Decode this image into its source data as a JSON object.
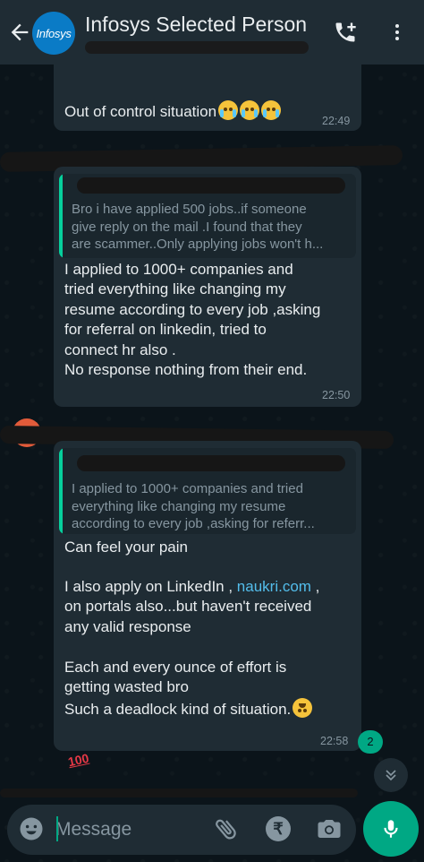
{
  "header": {
    "title": "Infosys Selected Person",
    "avatar_text": "Infosys"
  },
  "messages": [
    {
      "text": "Out of control situation",
      "time": "22:49"
    },
    {
      "quote": "Bro i have applied 500 jobs..if someone\ngive reply on the mail .I found that they\nare scammer..Only applying jobs won't h...",
      "text": "I applied to 1000+ companies and\ntried everything like changing my\nresume according to every job ,asking\nfor  referral on linkedin, tried to\nconnect hr also .\nNo response nothing from their end.",
      "time": "22:50"
    },
    {
      "quote": "I applied to 1000+ companies and tried\neverything like changing my resume\naccording to every job ,asking for  referr...",
      "text_a": "Can feel your pain",
      "text_b1": "I also apply on LinkedIn , ",
      "link": "naukri.com",
      "text_b2": " ,\non portals also...but haven't  received\nany valid response",
      "text_c": "Each and every ounce of effort is\ngetting wasted bro\nSuch a deadlock kind of situation.",
      "time": "22:58"
    }
  ],
  "unread_count": "2",
  "reaction": "100",
  "composer": {
    "placeholder": "Message",
    "currency_symbol": "₹"
  },
  "colors": {
    "accent": "#00a884",
    "bubble": "#1f2c34",
    "link": "#53bdeb"
  }
}
